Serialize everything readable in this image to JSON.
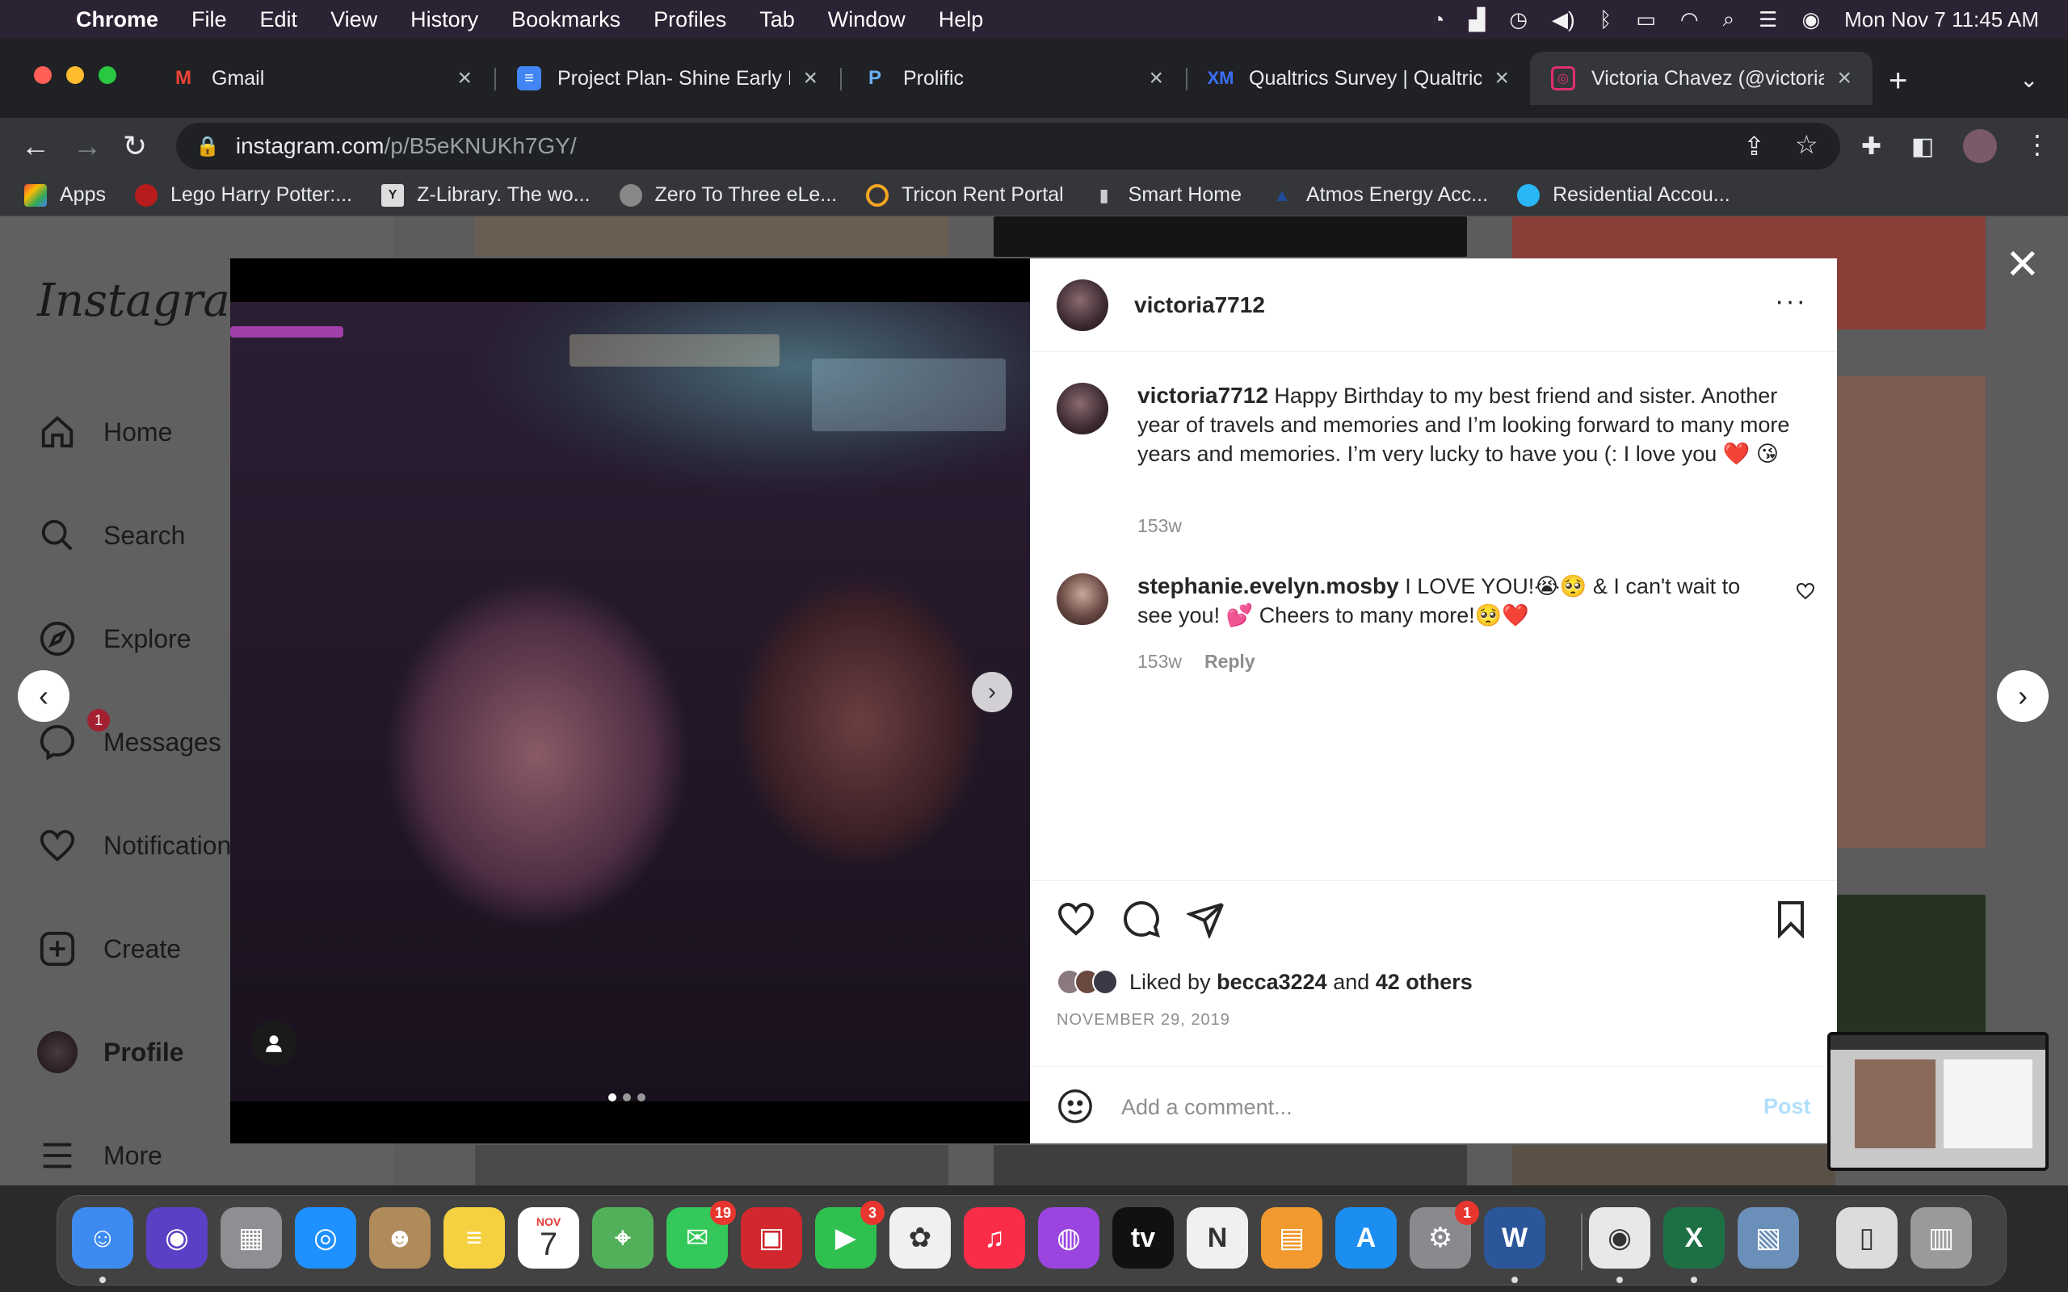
{
  "menubar": {
    "app": "Chrome",
    "items": [
      "File",
      "Edit",
      "View",
      "History",
      "Bookmarks",
      "Profiles",
      "Tab",
      "Window",
      "Help"
    ],
    "clock": "Mon Nov 7  11:45 AM"
  },
  "tabs": [
    {
      "title": "Gmail",
      "icon": "gmail-icon",
      "color": "#ea4335"
    },
    {
      "title": "Project Plan- Shine Early L",
      "icon": "docs-icon",
      "color": "#4285f4"
    },
    {
      "title": "Prolific",
      "icon": "prolific-icon",
      "color": "#6ab0f0"
    },
    {
      "title": "Qualtrics Survey | Qualtric",
      "icon": "qualtrics-icon",
      "color": "#3a6ff7"
    },
    {
      "title": "Victoria Chavez (@victoria",
      "icon": "instagram-icon",
      "color": "#e1306c"
    }
  ],
  "omnibox": {
    "host": "instagram.com",
    "path": "/p/B5eKNUKh7GY/"
  },
  "bookmarks": [
    {
      "label": "Apps",
      "color": "#ea4335"
    },
    {
      "label": "Lego Harry Potter:...",
      "color": "#b71c1c"
    },
    {
      "label": "Z-Library. The wo...",
      "color": "#dddddd"
    },
    {
      "label": "Zero To Three eLe...",
      "color": "#888888"
    },
    {
      "label": "Tricon Rent Portal",
      "color": "#f4a522"
    },
    {
      "label": "Smart Home",
      "color": "#cccccc"
    },
    {
      "label": "Atmos Energy Acc...",
      "color": "#1e4c9a"
    },
    {
      "label": "Residential Accou...",
      "color": "#29b6f6"
    }
  ],
  "sidebar": {
    "logo": "Instagram",
    "items": [
      "Home",
      "Search",
      "Explore",
      "Messages",
      "Notifications",
      "Create",
      "Profile",
      "More"
    ],
    "messages_badge": "1"
  },
  "post": {
    "username": "victoria7712",
    "caption_user": "victoria7712",
    "caption": " Happy Birthday to my best friend and sister. Another year of travels and memories and I’m looking forward to many more years and memories. I’m very lucky to have you (: I love you ❤️ 😘",
    "caption_age": "153w",
    "comment_user": "stephanie.evelyn.mosby",
    "comment": " I LOVE YOU!😭🥺 & I can't wait to see you! 💕 Cheers to many more!🥺❤️",
    "comment_age": "153w",
    "reply_label": "Reply",
    "liked_prefix": "Liked by ",
    "liked_user": "becca3224",
    "liked_mid": " and ",
    "liked_others": "42 others",
    "date": "NOVEMBER 29, 2019",
    "comment_placeholder": "Add a comment...",
    "post_label": "Post",
    "carousel_index": 1,
    "carousel_count": 3
  },
  "dock": {
    "apps": [
      {
        "name": "Finder",
        "glyph": "☺",
        "color": "#3d8bf0",
        "running": true
      },
      {
        "name": "Siri",
        "glyph": "◉",
        "color": "#5b3fc4"
      },
      {
        "name": "Launchpad",
        "glyph": "▦",
        "color": "#8e8e93"
      },
      {
        "name": "Safari",
        "glyph": "◎",
        "color": "#1e90ff"
      },
      {
        "name": "Contacts",
        "glyph": "☻",
        "color": "#b08a5a"
      },
      {
        "name": "Notes",
        "glyph": "≡",
        "color": "#f5d142"
      },
      {
        "name": "Calendar",
        "glyph": "7",
        "color": "#ffffff"
      },
      {
        "name": "Maps",
        "glyph": "⌖",
        "color": "#52b05a"
      },
      {
        "name": "Messages",
        "glyph": "✉",
        "color": "#34c759",
        "badge": "19"
      },
      {
        "name": "Photo Booth",
        "glyph": "▣",
        "color": "#d0282e"
      },
      {
        "name": "FaceTime",
        "glyph": "▶",
        "color": "#30c050",
        "badge": "3"
      },
      {
        "name": "Photos",
        "glyph": "✿",
        "color": "#f0f0f0"
      },
      {
        "name": "Music",
        "glyph": "♫",
        "color": "#fa2d48"
      },
      {
        "name": "Podcasts",
        "glyph": "◍",
        "color": "#9b45e0"
      },
      {
        "name": "TV",
        "glyph": "tv",
        "color": "#111111"
      },
      {
        "name": "News",
        "glyph": "N",
        "color": "#f0f0f0"
      },
      {
        "name": "Books",
        "glyph": "▤",
        "color": "#f29a30"
      },
      {
        "name": "App Store",
        "glyph": "A",
        "color": "#1c8ef0"
      },
      {
        "name": "System Preferences",
        "glyph": "⚙",
        "color": "#8a8a8e",
        "badge": "1"
      },
      {
        "name": "Word",
        "glyph": "W",
        "color": "#2b579a",
        "running": true
      },
      {
        "name": "Chrome",
        "glyph": "◉",
        "color": "#e8e8e8",
        "running": true
      },
      {
        "name": "Excel",
        "glyph": "X",
        "color": "#1d7044",
        "running": true
      },
      {
        "name": "Preview",
        "glyph": "▧",
        "color": "#6a8fb8"
      },
      {
        "name": "Documents",
        "glyph": "▯",
        "color": "#dcdcdc"
      },
      {
        "name": "Trash",
        "glyph": "▥",
        "color": "#9a9a9a"
      }
    ],
    "calendar_month": "NOV",
    "calendar_day": "7"
  }
}
